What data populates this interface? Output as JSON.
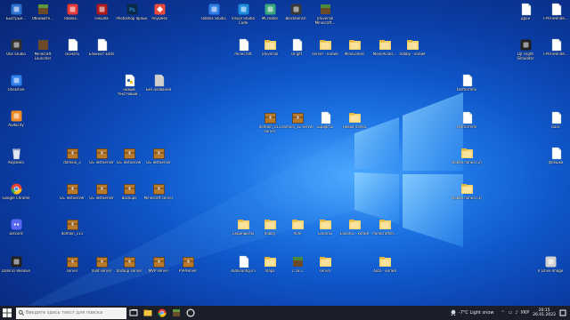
{
  "desktop_icons": [
    {
      "label": "Быстрые…",
      "icon": "app-icon",
      "color": "#2b6fcf"
    },
    {
      "label": "Обновите…",
      "icon": "minecraft-icon",
      "color": "#5a9a3c"
    },
    {
      "label": "Roblox…",
      "icon": "app-icon",
      "color": "#e53935"
    },
    {
      "label": "FileZilla",
      "icon": "app-icon",
      "color": "#b01c1c"
    },
    {
      "label": "Photoshop ярлык",
      "icon": "photoshop-icon",
      "color": "#0b2a4a"
    },
    {
      "label": "AnyDesk",
      "icon": "anydesk-icon",
      "color": "#e94a3a"
    },
    {
      "label": "Roblox Studio",
      "icon": "app-icon",
      "color": "#2d7be5"
    },
    {
      "label": "Visual Studio Code",
      "icon": "app-icon",
      "color": "#1c8adb"
    },
    {
      "label": "MCreator",
      "icon": "app-icon",
      "color": "#3aa87a"
    },
    {
      "label": "Blockbench",
      "icon": "app-icon",
      "color": "#3a3a3a"
    },
    {
      "label": "Universal Minecraft…",
      "icon": "minecraft-icon",
      "color": "#4a8a3a"
    },
    {
      "label": "дрон",
      "icon": "file-icon",
      "color": "#ffffff"
    },
    {
      "label": "FPVFreeride…",
      "icon": "file-icon",
      "color": "#ffffff"
    },
    {
      "label": "Obs Studio",
      "icon": "app-icon",
      "color": "#303030"
    },
    {
      "label": "Minecraft Launcher",
      "icon": "minecraft-icon",
      "color": "#6b4a2a"
    },
    {
      "label": "скачать",
      "icon": "file-icon",
      "color": "#ffffff"
    },
    {
      "label": "Блокнот Edits",
      "icon": "file-icon",
      "color": "#ffffff"
    },
    {
      "label": "minecraft",
      "icon": "file-icon",
      "color": "#ffffff"
    },
    {
      "label": "Universal",
      "icon": "folder-icon",
      "color": "#f5d36b"
    },
    {
      "label": "sd gift",
      "icon": "file-icon",
      "color": "#ffffff"
    },
    {
      "label": "server - копия",
      "icon": "folder-icon",
      "color": "#f5d36b"
    },
    {
      "label": "MiniGames",
      "icon": "folder-icon",
      "color": "#f5d36b"
    },
    {
      "label": "MoonAcidis…",
      "icon": "folder-icon",
      "color": "#f5d36b"
    },
    {
      "label": "hobby - копия",
      "icon": "folder-icon",
      "color": "#f5d36b"
    },
    {
      "label": "DJI Flight Simulator",
      "icon": "app-icon",
      "color": "#202020"
    },
    {
      "label": "FPVFreeride…",
      "icon": "file-icon",
      "color": "#ffffff"
    },
    {
      "label": "OneDrive",
      "icon": "app-icon",
      "color": "#2f80ed"
    },
    {
      "label": "новый текстовый…",
      "icon": "python-icon",
      "color": "#ffffff"
    },
    {
      "label": "Без названия",
      "icon": "file-icon",
      "color": "#cfcfcf"
    },
    {
      "label": "textformmi",
      "icon": "file-icon",
      "color": "#ffffff"
    },
    {
      "label": "Audacity",
      "icon": "app-icon",
      "color": "#f08a24"
    },
    {
      "label": "domain_111 server",
      "icon": "chest-icon",
      "color": "#b8792a"
    },
    {
      "label": "domain_12 server",
      "icon": "chest-icon",
      "color": "#b8792a"
    },
    {
      "label": "шрифты",
      "icon": "file-icon",
      "color": "#ffffff"
    },
    {
      "label": "Новая папка",
      "icon": "folder-icon",
      "color": "#f5d36b"
    },
    {
      "label": "textformmi",
      "icon": "file-icon",
      "color": "#ffffff"
    },
    {
      "label": "back",
      "icon": "file-icon",
      "color": "#ffffff"
    },
    {
      "label": "Корзина",
      "icon": "recycle-bin-icon",
      "color": "#dfe8f2"
    },
    {
      "label": "domain_2",
      "icon": "chest-icon",
      "color": "#b8792a"
    },
    {
      "label": "GS TestServer",
      "icon": "chest-icon",
      "color": "#b8792a"
    },
    {
      "label": "GS TestServer",
      "icon": "chest-icon",
      "color": "#b8792a"
    },
    {
      "label": "GS TestServer",
      "icon": "chest-icon",
      "color": "#b8792a"
    },
    {
      "label": "Новая папка (2)",
      "icon": "folder-icon",
      "color": "#f5d36b"
    },
    {
      "label": "флешка",
      "icon": "file-icon",
      "color": "#ffffff"
    },
    {
      "label": "Google Chrome",
      "icon": "chrome-icon",
      "color": "#ea4335"
    },
    {
      "label": "GS TestServer",
      "icon": "chest-icon",
      "color": "#b8792a"
    },
    {
      "label": "GS TestServer",
      "icon": "chest-icon",
      "color": "#b8792a"
    },
    {
      "label": "Backups",
      "icon": "chest-icon",
      "color": "#b8792a"
    },
    {
      "label": "Minecraft server",
      "icon": "chest-icon",
      "color": "#b8792a"
    },
    {
      "label": "Новая папка (3)",
      "icon": "folder-icon",
      "color": "#f5d36b"
    },
    {
      "label": "Discord",
      "icon": "discord-icon",
      "color": "#5865f2"
    },
    {
      "label": "domain_111",
      "icon": "chest-icon",
      "color": "#b8792a"
    },
    {
      "label": "Скриншоты",
      "icon": "folder-icon",
      "color": "#f5d36b"
    },
    {
      "label": "hobby",
      "icon": "folder-icon",
      "color": "#f5d36b"
    },
    {
      "label": "Aide",
      "icon": "folder-icon",
      "color": "#f5d36b"
    },
    {
      "label": "Бэкапы",
      "icon": "folder-icon",
      "color": "#f5d36b"
    },
    {
      "label": "Бэкапы - копия",
      "icon": "folder-icon",
      "color": "#f5d36b"
    },
    {
      "label": "minecraftsh…",
      "icon": "folder-icon",
      "color": "#f5d36b"
    },
    {
      "label": "DaVinci Resolve",
      "icon": "app-icon",
      "color": "#222222"
    },
    {
      "label": "server",
      "icon": "chest-icon",
      "color": "#b8792a"
    },
    {
      "label": "mod server",
      "icon": "chest-icon",
      "color": "#b8792a"
    },
    {
      "label": "backup server",
      "icon": "chest-icon",
      "color": "#b8792a"
    },
    {
      "label": "MVP server",
      "icon": "chest-icon",
      "color": "#b8792a"
    },
    {
      "label": "PVPserver",
      "icon": "chest-icon",
      "color": "#b8792a"
    },
    {
      "label": "Autoconfig.ini",
      "icon": "file-icon",
      "color": "#ffffff"
    },
    {
      "label": "maps",
      "icon": "folder-icon",
      "color": "#f5d36b"
    },
    {
      "label": "1.18.1",
      "icon": "minecraft-icon",
      "color": "#4a8a3a"
    },
    {
      "label": "server",
      "icon": "folder-icon",
      "color": "#f5d36b"
    },
    {
      "label": "Auto - копия",
      "icon": "folder-icon",
      "color": "#f5d36b"
    },
    {
      "label": "R Drive Image",
      "icon": "app-icon",
      "color": "#d0d0d0"
    }
  ],
  "taskbar": {
    "search_placeholder": "Введите здесь текст для поиска",
    "weather": "-7°C  Light snow",
    "language": "УКР",
    "time": "20:15",
    "date": "26.01.2022"
  }
}
